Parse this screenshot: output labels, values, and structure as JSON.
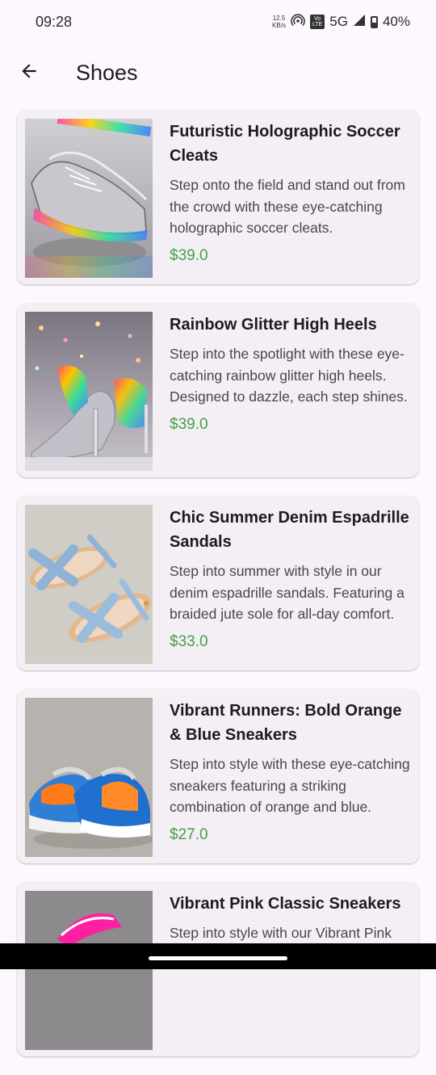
{
  "status_bar": {
    "time": "09:28",
    "speed_value": "12.5",
    "speed_unit": "KB/s",
    "lte_top": "Vo",
    "lte_bottom": "LTE",
    "network": "5G",
    "battery": "40%"
  },
  "app_bar": {
    "title": "Shoes",
    "back_icon": "arrow-back-icon"
  },
  "products": [
    {
      "title": "Futuristic Holographic Soccer Cleats",
      "description": "Step onto the field and stand out from the crowd with these eye-catching holographic soccer cleats.",
      "price": "$39.0"
    },
    {
      "title": "Rainbow Glitter High Heels",
      "description": "Step into the spotlight with these eye-catching rainbow glitter high heels. Designed to dazzle, each step shines.",
      "price": "$39.0"
    },
    {
      "title": "Chic Summer Denim Espadrille Sandals",
      "description": "Step into summer with style in our denim espadrille sandals. Featuring a braided jute sole for all-day comfort.",
      "price": "$33.0"
    },
    {
      "title": "Vibrant Runners: Bold Orange & Blue Sneakers",
      "description": "Step into style with these eye-catching sneakers featuring a striking combination of orange and blue.",
      "price": "$27.0"
    },
    {
      "title": "Vibrant Pink Classic Sneakers",
      "description": "Step into style with our Vibrant Pink Classic Sneakers.",
      "price": ""
    }
  ],
  "colors": {
    "price": "#43a047",
    "card_bg": "#f4eff4",
    "page_bg": "#fdf8fd"
  }
}
